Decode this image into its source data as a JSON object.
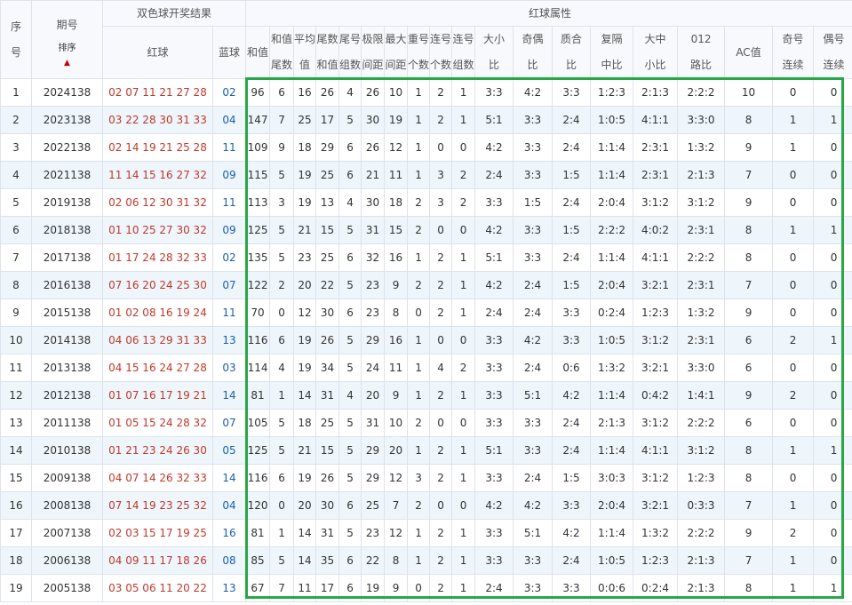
{
  "header": {
    "seq_label": [
      "序",
      "号"
    ],
    "issue_label": "期号",
    "sort_label": "排序",
    "draw_group_label": "双色球开奖结果",
    "red_ball_label": "红球",
    "blue_ball_label": "蓝球",
    "attr_group_label": "红球属性",
    "attr_columns": [
      [
        "和值"
      ],
      [
        "和值",
        "尾数"
      ],
      [
        "平均",
        "值"
      ],
      [
        "尾数",
        "和值"
      ],
      [
        "尾号",
        "组数"
      ],
      [
        "极限",
        "间距"
      ],
      [
        "最大",
        "间距"
      ],
      [
        "重号",
        "个数"
      ],
      [
        "连号",
        "个数"
      ],
      [
        "连号",
        "组数"
      ],
      [
        "大小",
        "比"
      ],
      [
        "奇偶",
        "比"
      ],
      [
        "质合",
        "比"
      ],
      [
        "复隔",
        "中比"
      ],
      [
        "大中",
        "小比"
      ],
      [
        "012",
        "路比"
      ],
      [
        "AC值"
      ],
      [
        "奇号",
        "连续"
      ],
      [
        "偶号",
        "连续"
      ]
    ]
  },
  "rows": [
    {
      "seq": "1",
      "issue": "2024138",
      "red": "02 07 11 21 27 28",
      "blue": "02",
      "attrs": [
        "96",
        "6",
        "16",
        "26",
        "4",
        "26",
        "10",
        "1",
        "2",
        "1",
        "3:3",
        "4:2",
        "3:3",
        "1:2:3",
        "2:1:3",
        "2:2:2",
        "10",
        "0",
        "0"
      ]
    },
    {
      "seq": "2",
      "issue": "2023138",
      "red": "03 22 28 30 31 33",
      "blue": "04",
      "attrs": [
        "147",
        "7",
        "25",
        "17",
        "5",
        "30",
        "19",
        "1",
        "2",
        "1",
        "5:1",
        "3:3",
        "2:4",
        "1:0:5",
        "4:1:1",
        "3:3:0",
        "8",
        "1",
        "1"
      ]
    },
    {
      "seq": "3",
      "issue": "2022138",
      "red": "02 14 19 21 25 28",
      "blue": "11",
      "attrs": [
        "109",
        "9",
        "18",
        "29",
        "6",
        "26",
        "12",
        "1",
        "0",
        "0",
        "4:2",
        "3:3",
        "2:4",
        "1:1:4",
        "2:3:1",
        "1:3:2",
        "9",
        "1",
        "0"
      ]
    },
    {
      "seq": "4",
      "issue": "2021138",
      "red": "11 14 15 16 27 32",
      "blue": "09",
      "attrs": [
        "115",
        "5",
        "19",
        "25",
        "6",
        "21",
        "11",
        "1",
        "3",
        "2",
        "2:4",
        "3:3",
        "1:5",
        "1:1:4",
        "2:3:1",
        "2:1:3",
        "7",
        "0",
        "0"
      ]
    },
    {
      "seq": "5",
      "issue": "2019138",
      "red": "02 06 12 30 31 32",
      "blue": "11",
      "attrs": [
        "113",
        "3",
        "19",
        "13",
        "4",
        "30",
        "18",
        "2",
        "3",
        "2",
        "3:3",
        "1:5",
        "2:4",
        "2:0:4",
        "3:1:2",
        "3:1:2",
        "9",
        "0",
        "0"
      ]
    },
    {
      "seq": "6",
      "issue": "2018138",
      "red": "01 10 25 27 30 32",
      "blue": "09",
      "attrs": [
        "125",
        "5",
        "21",
        "15",
        "5",
        "31",
        "15",
        "2",
        "0",
        "0",
        "4:2",
        "3:3",
        "1:5",
        "2:2:2",
        "4:0:2",
        "2:3:1",
        "8",
        "1",
        "1"
      ]
    },
    {
      "seq": "7",
      "issue": "2017138",
      "red": "01 17 24 28 32 33",
      "blue": "02",
      "attrs": [
        "135",
        "5",
        "23",
        "25",
        "6",
        "32",
        "16",
        "1",
        "2",
        "1",
        "5:1",
        "3:3",
        "2:4",
        "1:1:4",
        "4:1:1",
        "2:2:2",
        "8",
        "0",
        "0"
      ]
    },
    {
      "seq": "8",
      "issue": "2016138",
      "red": "07 16 20 24 25 30",
      "blue": "07",
      "attrs": [
        "122",
        "2",
        "20",
        "22",
        "5",
        "23",
        "9",
        "2",
        "2",
        "1",
        "4:2",
        "2:4",
        "1:5",
        "2:0:4",
        "3:2:1",
        "2:3:1",
        "7",
        "0",
        "0"
      ]
    },
    {
      "seq": "9",
      "issue": "2015138",
      "red": "01 02 08 16 19 24",
      "blue": "11",
      "attrs": [
        "70",
        "0",
        "12",
        "30",
        "6",
        "23",
        "8",
        "0",
        "2",
        "1",
        "2:4",
        "2:4",
        "3:3",
        "0:2:4",
        "1:2:3",
        "1:3:2",
        "9",
        "0",
        "0"
      ]
    },
    {
      "seq": "10",
      "issue": "2014138",
      "red": "04 06 13 29 31 33",
      "blue": "13",
      "attrs": [
        "116",
        "6",
        "19",
        "26",
        "5",
        "29",
        "16",
        "1",
        "0",
        "0",
        "3:3",
        "4:2",
        "3:3",
        "1:0:5",
        "3:1:2",
        "2:3:1",
        "6",
        "2",
        "1"
      ]
    },
    {
      "seq": "11",
      "issue": "2013138",
      "red": "04 15 16 24 27 28",
      "blue": "03",
      "attrs": [
        "114",
        "4",
        "19",
        "34",
        "5",
        "24",
        "11",
        "1",
        "4",
        "2",
        "3:3",
        "2:4",
        "0:6",
        "1:3:2",
        "3:2:1",
        "3:3:0",
        "6",
        "0",
        "0"
      ]
    },
    {
      "seq": "12",
      "issue": "2012138",
      "red": "01 07 16 17 19 21",
      "blue": "14",
      "attrs": [
        "81",
        "1",
        "14",
        "31",
        "4",
        "20",
        "9",
        "1",
        "2",
        "1",
        "3:3",
        "5:1",
        "4:2",
        "1:1:4",
        "0:4:2",
        "1:4:1",
        "9",
        "2",
        "0"
      ]
    },
    {
      "seq": "13",
      "issue": "2011138",
      "red": "01 05 15 24 28 32",
      "blue": "07",
      "attrs": [
        "105",
        "5",
        "18",
        "25",
        "5",
        "31",
        "10",
        "2",
        "0",
        "0",
        "3:3",
        "3:3",
        "2:4",
        "2:1:3",
        "3:1:2",
        "2:2:2",
        "6",
        "0",
        "0"
      ]
    },
    {
      "seq": "14",
      "issue": "2010138",
      "red": "01 21 23 24 26 30",
      "blue": "05",
      "attrs": [
        "125",
        "5",
        "21",
        "15",
        "5",
        "29",
        "20",
        "1",
        "2",
        "1",
        "5:1",
        "3:3",
        "2:4",
        "1:1:4",
        "4:1:1",
        "3:1:2",
        "8",
        "1",
        "1"
      ]
    },
    {
      "seq": "15",
      "issue": "2009138",
      "red": "04 07 14 26 32 33",
      "blue": "14",
      "attrs": [
        "116",
        "6",
        "19",
        "26",
        "5",
        "29",
        "12",
        "3",
        "2",
        "1",
        "3:3",
        "2:4",
        "1:5",
        "3:0:3",
        "3:1:2",
        "1:2:3",
        "8",
        "0",
        "0"
      ]
    },
    {
      "seq": "16",
      "issue": "2008138",
      "red": "07 14 19 23 25 32",
      "blue": "04",
      "attrs": [
        "120",
        "0",
        "20",
        "30",
        "6",
        "25",
        "7",
        "2",
        "0",
        "0",
        "4:2",
        "4:2",
        "3:3",
        "2:0:4",
        "3:2:1",
        "0:3:3",
        "7",
        "1",
        "0"
      ]
    },
    {
      "seq": "17",
      "issue": "2007138",
      "red": "02 03 15 17 19 25",
      "blue": "16",
      "attrs": [
        "81",
        "1",
        "14",
        "31",
        "5",
        "23",
        "12",
        "1",
        "2",
        "1",
        "3:3",
        "5:1",
        "4:2",
        "1:1:4",
        "1:3:2",
        "2:2:2",
        "9",
        "2",
        "0"
      ]
    },
    {
      "seq": "18",
      "issue": "2006138",
      "red": "04 09 11 17 18 26",
      "blue": "08",
      "attrs": [
        "85",
        "5",
        "14",
        "35",
        "6",
        "22",
        "8",
        "1",
        "2",
        "1",
        "3:3",
        "3:3",
        "2:4",
        "1:0:5",
        "1:2:3",
        "2:1:3",
        "7",
        "1",
        "0"
      ]
    },
    {
      "seq": "19",
      "issue": "2005138",
      "red": "03 05 06 11 20 22",
      "blue": "13",
      "attrs": [
        "67",
        "7",
        "11",
        "17",
        "6",
        "19",
        "9",
        "0",
        "2",
        "1",
        "2:4",
        "3:3",
        "3:3",
        "0:0:6",
        "0:2:4",
        "2:1:3",
        "8",
        "1",
        "1"
      ]
    }
  ],
  "highlight_color": "#27a844"
}
